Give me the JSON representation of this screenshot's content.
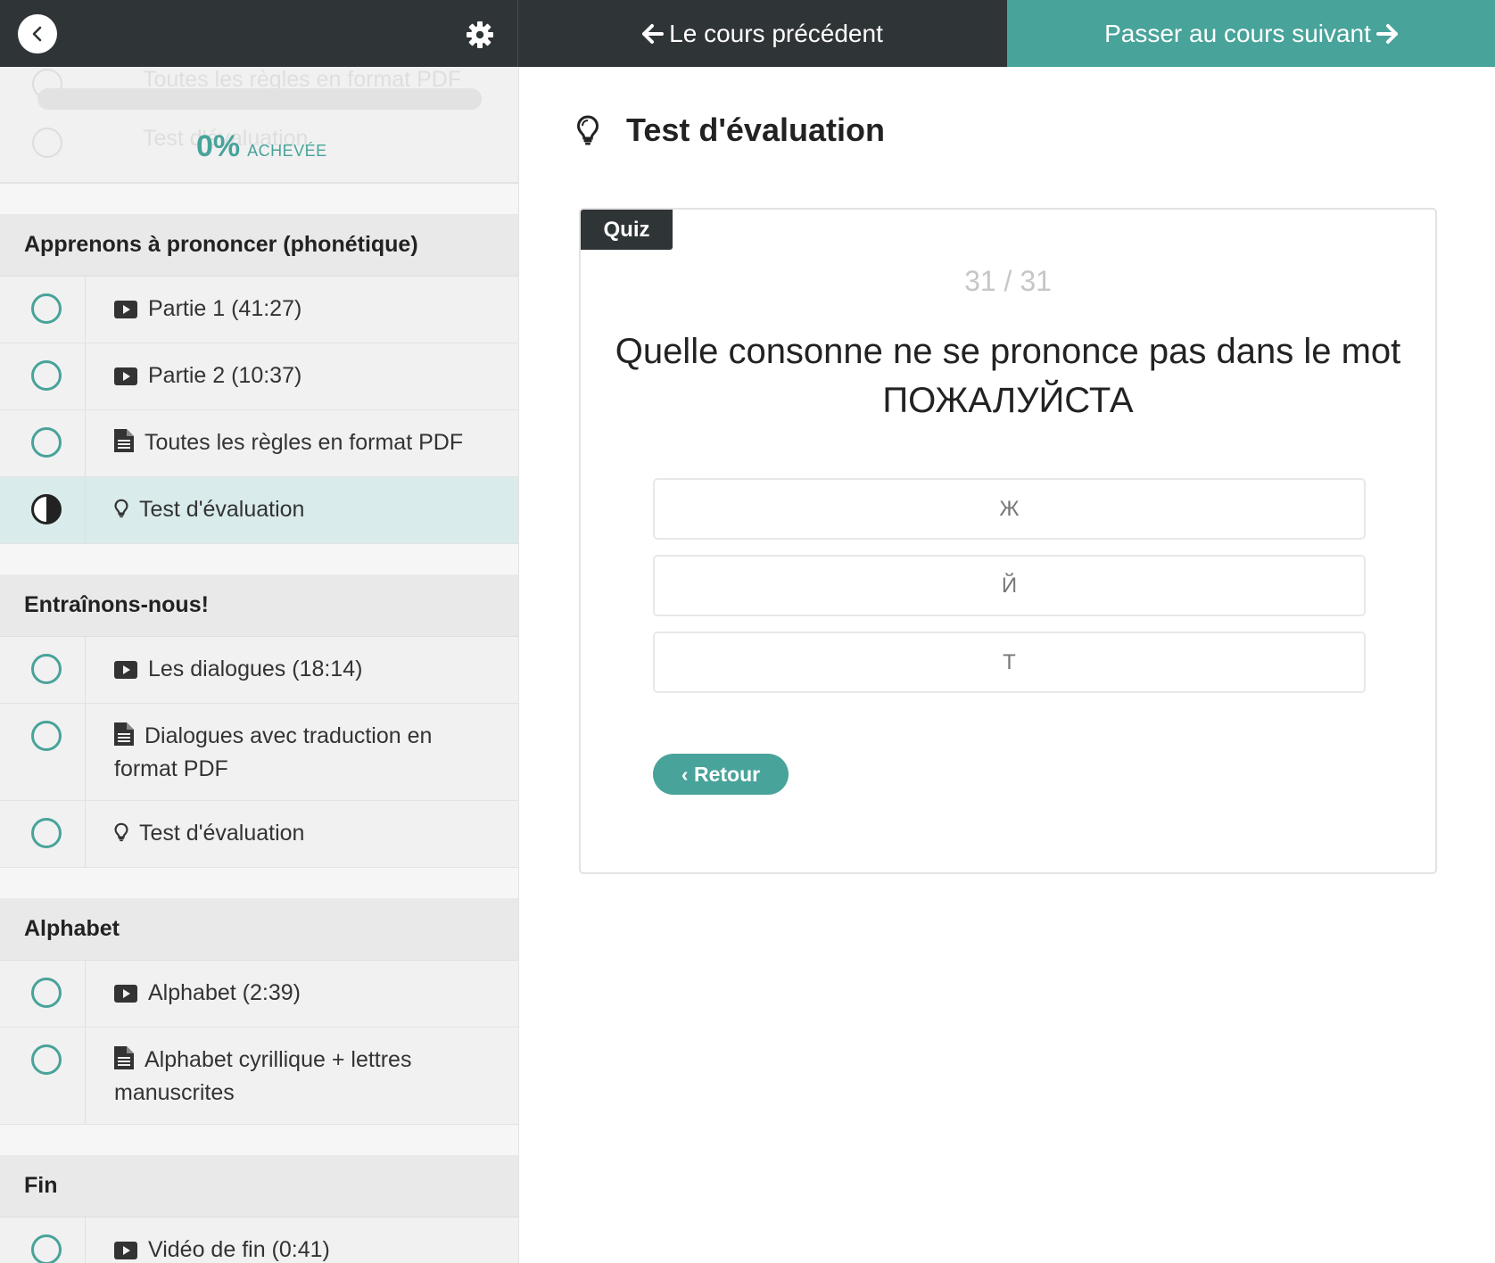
{
  "header": {
    "prev_label": "Le cours précédent",
    "next_label": "Passer au cours suivant"
  },
  "colors": {
    "accent": "#48a39a",
    "dark": "#2f3437",
    "active_row": "#d9ebeb"
  },
  "progress": {
    "ghost_items": [
      "Toutes les règles en format PDF",
      "Test d'évaluation"
    ],
    "percent": "0%",
    "percent_value": 0,
    "label": "ACHEVÉE"
  },
  "sections": [
    {
      "title": "Apprenons à prononcer (phonétique)",
      "items": [
        {
          "icon": "video-icon",
          "label": "Partie 1 (41:27)",
          "status": "not-started"
        },
        {
          "icon": "video-icon",
          "label": "Partie 2 (10:37)",
          "status": "not-started"
        },
        {
          "icon": "document-icon",
          "label": "Toutes les règles en format PDF",
          "status": "not-started"
        },
        {
          "icon": "lightbulb-icon",
          "label": "Test d'évaluation",
          "status": "in-progress",
          "active": true
        }
      ]
    },
    {
      "title": "Entraînons-nous!",
      "items": [
        {
          "icon": "video-icon",
          "label": "Les dialogues (18:14)",
          "status": "not-started"
        },
        {
          "icon": "document-icon",
          "label": "Dialogues avec traduction en format PDF",
          "status": "not-started"
        },
        {
          "icon": "lightbulb-icon",
          "label": "Test d'évaluation",
          "status": "not-started"
        }
      ]
    },
    {
      "title": "Alphabet",
      "items": [
        {
          "icon": "video-icon",
          "label": "Alphabet (2:39)",
          "status": "not-started"
        },
        {
          "icon": "document-icon",
          "label": "Alphabet cyrillique + lettres manuscrites",
          "status": "not-started"
        }
      ]
    },
    {
      "title": "Fin",
      "items": [
        {
          "icon": "video-icon",
          "label": "Vidéo de fin (0:41)",
          "status": "not-started"
        }
      ]
    }
  ],
  "main": {
    "title": "Test d'évaluation",
    "quiz": {
      "tag": "Quiz",
      "counter": "31 / 31",
      "question": "Quelle consonne ne se prononce pas dans le mot",
      "word": "ПОЖАЛУЙСТА",
      "answers": [
        "Ж",
        "Й",
        "Т"
      ],
      "back_label": "‹ Retour"
    }
  }
}
